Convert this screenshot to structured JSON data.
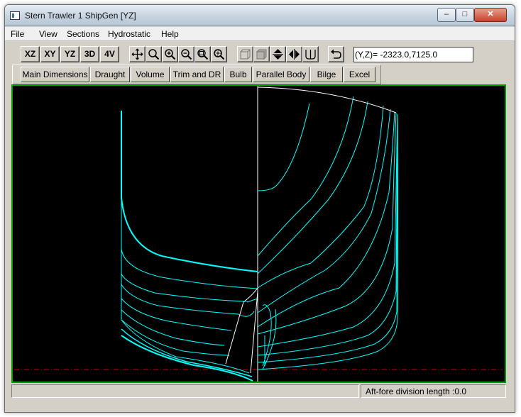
{
  "window": {
    "title": "Stern Trawler  1 ShipGen [YZ]"
  },
  "window_controls": {
    "minimize": "–",
    "maximize": "□",
    "close": "✕"
  },
  "menu": [
    "File",
    "View",
    "Sections",
    "Hydrostatic",
    "Help"
  ],
  "view_buttons": [
    "XZ",
    "XY",
    "YZ",
    "3D",
    "4V"
  ],
  "tool_icons": [
    "move-icon",
    "zoom-icon",
    "zoom-in-icon",
    "zoom-out-icon",
    "zoom-window-icon",
    "zoom-extents-icon",
    "cube-wire-icon",
    "cube-solid-icon",
    "flip-vertical-icon",
    "flip-horizontal-icon",
    "section-icon",
    "undo-icon"
  ],
  "coordinate_readout": "(Y,Z)= -2323.0,7125.0",
  "tabs": [
    "Main Dimensions",
    "Draught",
    "Volume",
    "Trim and DR",
    "Bulb",
    "Parallel Body",
    "Bilge",
    "Excel"
  ],
  "status": {
    "left": "",
    "right": "Aft-fore division length :0.0"
  },
  "colors": {
    "hull_lines": "#00ffff",
    "centerline": "#ffffff",
    "baseline": "#cc0000",
    "canvas_bg": "#000000",
    "canvas_border": "#00a000"
  }
}
